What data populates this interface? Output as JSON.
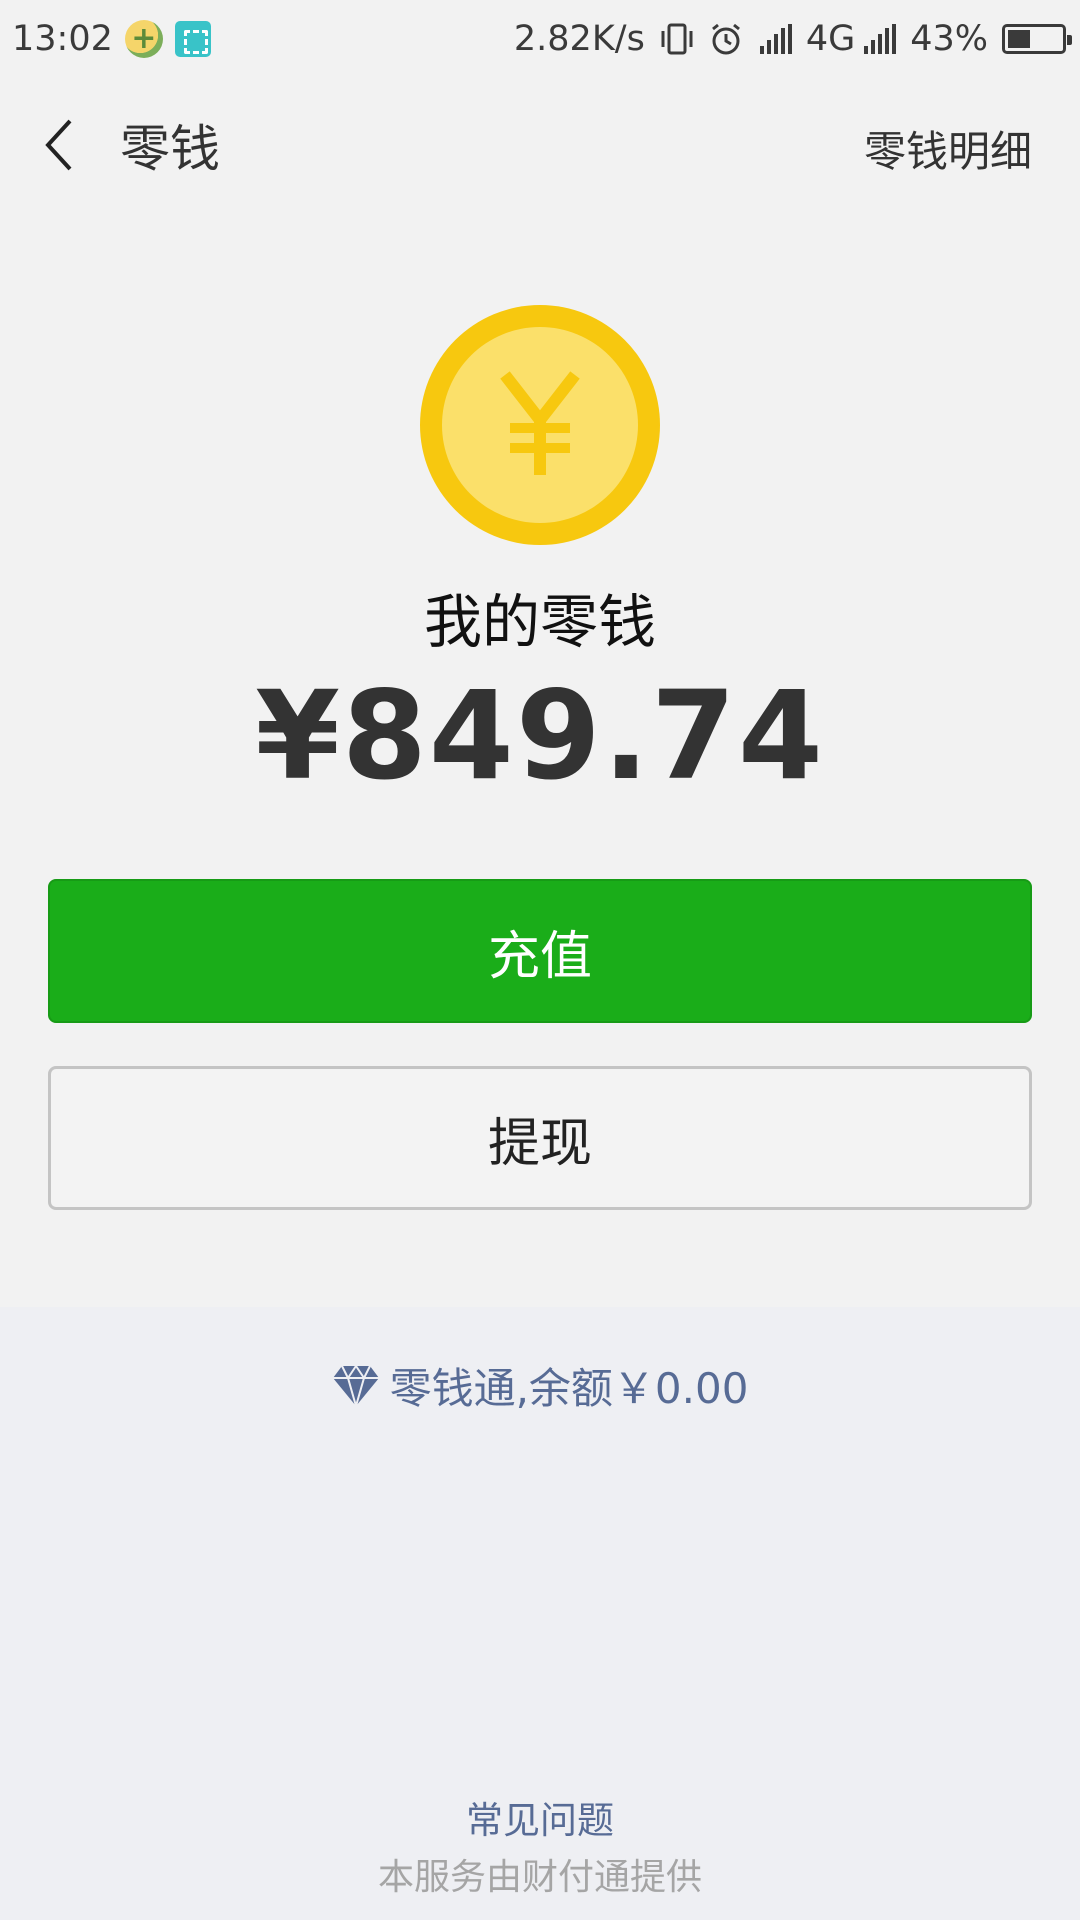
{
  "status_bar": {
    "time": "13:02",
    "net_speed": "2.82K/s",
    "network_label": "4G",
    "battery_percent": "43%",
    "battery_level": 0.43
  },
  "header": {
    "title": "零钱",
    "detail_link": "零钱明细"
  },
  "wallet": {
    "label": "我的零钱",
    "balance": "¥849.74",
    "coin_color": "#f7c80f"
  },
  "actions": {
    "recharge": "充值",
    "withdraw": "提现",
    "primary_color": "#1aad19"
  },
  "lingqiantong": {
    "text": "零钱通,余额￥0.00",
    "icon": "diamond-icon"
  },
  "footer": {
    "faq": "常见问题",
    "provider": "本服务由财付通提供"
  }
}
